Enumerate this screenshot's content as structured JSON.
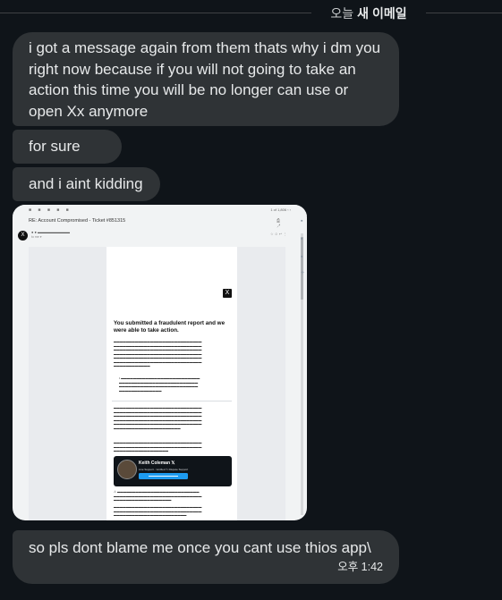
{
  "divider": {
    "day": "오늘",
    "label": "새 이메일"
  },
  "messages": [
    {
      "text": "i got a message again from them thats why i dm you right now because if you will not going to take an action this time you will be no longer can use or open Xx anymore"
    },
    {
      "text": "for sure"
    },
    {
      "text": "and i aint kidding"
    },
    {
      "text": "so pls dont blame me once you cant use thios app\\",
      "timestamp": "오후 1:42"
    }
  ],
  "screenshot": {
    "subject": "RE: Account Compromised - Ticket #851315",
    "heading": "You submitted a fraudulent report and we were able to take action.",
    "agent_name": "Keith Coleman 𝕏",
    "agent_role": "Live Support - Verified 𝕏 Dispute Support"
  }
}
